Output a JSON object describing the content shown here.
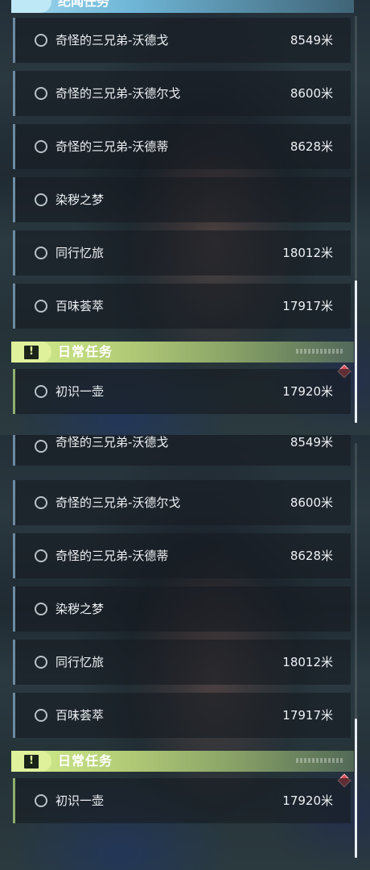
{
  "colors": {
    "world_quest_accent": "#6d8aa0",
    "daily_quest_accent": "#8fae6d",
    "daily_header_green": "#d5ef8f",
    "tracked_marker_red": "#d94b55"
  },
  "panel_top": {
    "prev_category_title": "纪闻任务",
    "quests": [
      {
        "name": "奇怪的三兄弟-沃德戈",
        "distance": "8549米"
      },
      {
        "name": "奇怪的三兄弟-沃德尔戈",
        "distance": "8600米"
      },
      {
        "name": "奇怪的三兄弟-沃德蒂",
        "distance": "8628米"
      },
      {
        "name": "染秽之梦",
        "distance": ""
      },
      {
        "name": "同行忆旅",
        "distance": "18012米"
      },
      {
        "name": "百味荟萃",
        "distance": "17917米"
      }
    ],
    "daily_header": {
      "icon": "exclamation-icon",
      "title": "日常任务"
    },
    "daily_quests": [
      {
        "name": "初识一壶",
        "distance": "17920米"
      }
    ]
  },
  "panel_bottom": {
    "quests": [
      {
        "name": "奇怪的三兄弟-沃德戈",
        "distance": "8549米"
      },
      {
        "name": "奇怪的三兄弟-沃德尔戈",
        "distance": "8600米"
      },
      {
        "name": "奇怪的三兄弟-沃德蒂",
        "distance": "8628米"
      },
      {
        "name": "染秽之梦",
        "distance": ""
      },
      {
        "name": "同行忆旅",
        "distance": "18012米"
      },
      {
        "name": "百味荟萃",
        "distance": "17917米"
      }
    ],
    "daily_header": {
      "icon": "exclamation-icon",
      "title": "日常任务"
    },
    "daily_quests": [
      {
        "name": "初识一壶",
        "distance": "17920米"
      }
    ]
  }
}
